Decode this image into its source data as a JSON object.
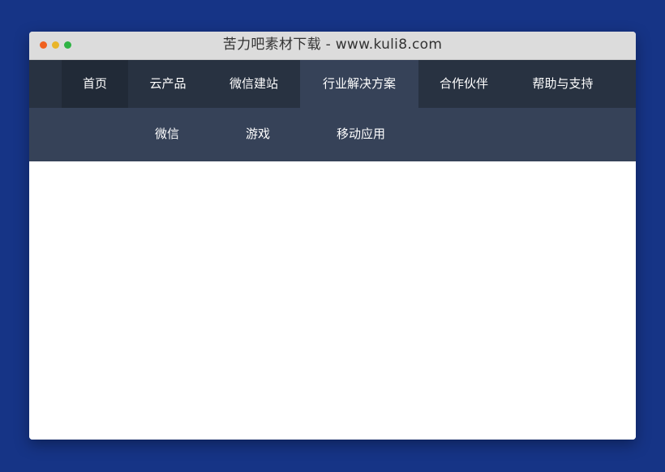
{
  "window": {
    "title": "苦力吧素材下载 - www.kuli8.com"
  },
  "nav": {
    "items": [
      {
        "label": "首页"
      },
      {
        "label": "云产品"
      },
      {
        "label": "微信建站"
      },
      {
        "label": "行业解决方案"
      },
      {
        "label": "合作伙伴"
      },
      {
        "label": "帮助与支持"
      }
    ],
    "active": "行业解决方案"
  },
  "subnav": {
    "items": [
      {
        "label": "微信"
      },
      {
        "label": "游戏"
      },
      {
        "label": "移动应用"
      }
    ]
  },
  "colors": {
    "page_background": "#163486",
    "nav_background": "#283241",
    "nav_home_background": "#212a37",
    "nav_active_background": "#364258",
    "subnav_background": "#364258",
    "titlebar_background": "#dcdcdc",
    "dot_close": "#f0611f",
    "dot_minimize": "#e9b52a",
    "dot_maximize": "#2fb344"
  }
}
